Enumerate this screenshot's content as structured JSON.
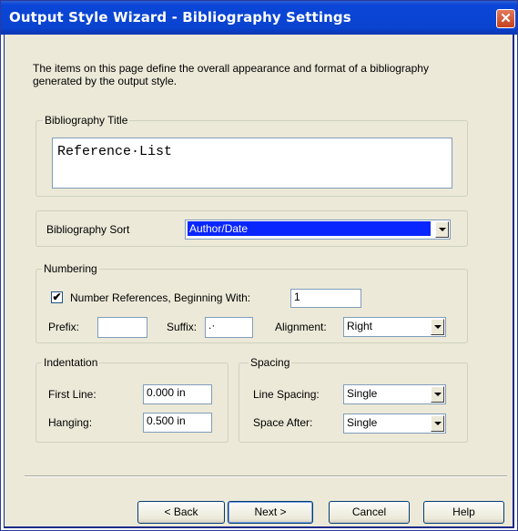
{
  "window": {
    "title": "Output Style Wizard - Bibliography Settings",
    "close_symbol": "✕"
  },
  "intro_text": "The items on this page define the overall appearance and format of a bibliography generated by the output style.",
  "bibliography_title": {
    "legend": "Bibliography Title",
    "value": "Reference·List"
  },
  "bibliography_sort": {
    "label": "Bibliography Sort",
    "value": "Author/Date"
  },
  "numbering": {
    "legend": "Numbering",
    "checkbox_mark": "✔",
    "checkbox_label": "Number References, Beginning With:",
    "checked": true,
    "begin_value": "1",
    "prefix_label": "Prefix:",
    "prefix_value": "",
    "suffix_label": "Suffix:",
    "suffix_value": ".·",
    "alignment_label": "Alignment:",
    "alignment_value": "Right"
  },
  "indentation": {
    "legend": "Indentation",
    "first_line_label": "First Line:",
    "first_line_value": "0.000 in",
    "hanging_label": "Hanging:",
    "hanging_value": "0.500 in"
  },
  "spacing": {
    "legend": "Spacing",
    "line_spacing_label": "Line Spacing:",
    "line_spacing_value": "Single",
    "space_after_label": "Space After:",
    "space_after_value": "Single"
  },
  "buttons": {
    "back": "< Back",
    "next": "Next >",
    "cancel": "Cancel",
    "help": "Help"
  },
  "colors": {
    "titlebar": "#0a46d8",
    "dialog_bg": "#ece9d8",
    "selection": "#0a26ff",
    "close": "#d4532e"
  }
}
